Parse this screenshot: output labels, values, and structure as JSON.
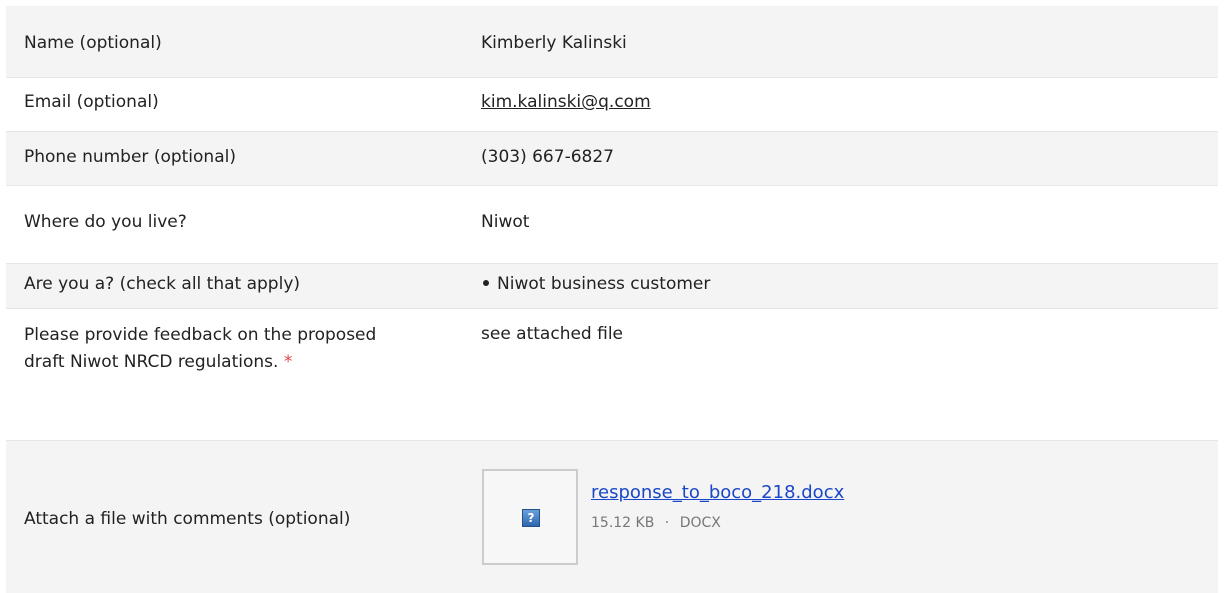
{
  "fields": [
    {
      "label": "Name (optional)",
      "value": "Kimberly  Kalinski"
    },
    {
      "label": "Email (optional)",
      "value": "kim.kalinski@q.com"
    },
    {
      "label": "Phone number (optional)",
      "value": "(303) 667-6827"
    },
    {
      "label": "Where do you live?",
      "value": "Niwot"
    },
    {
      "label": "Are you a? (check all that apply)",
      "value": "Niwot business customer"
    },
    {
      "label": "Please provide feedback on the proposed draft Niwot NRCD regulations.",
      "required_mark": "*",
      "value": "see attached file"
    },
    {
      "label": "Attach a file with comments (optional)"
    }
  ],
  "attachment": {
    "filename": "response_to_boco_218.docx",
    "size": "15.12 KB",
    "separator": "·",
    "type": "DOCX",
    "icon": "unknown-file-icon"
  }
}
